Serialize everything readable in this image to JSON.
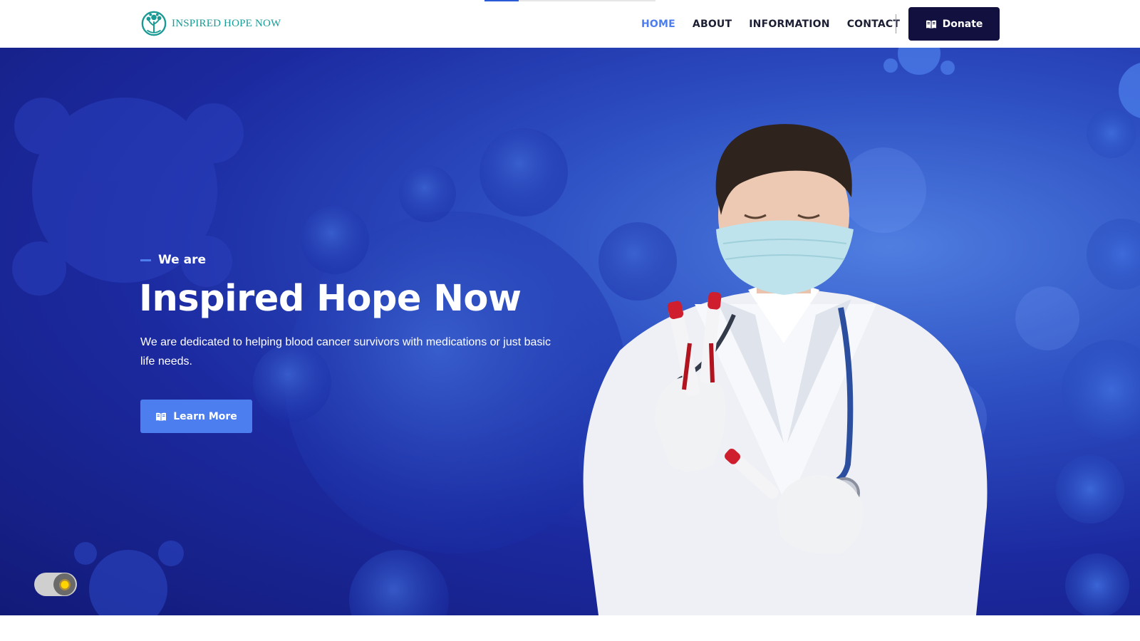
{
  "header": {
    "logo": {
      "text": "INSPIRED HOPE NOW",
      "icon": "tree-leaf-logo-icon",
      "color": "#1a9a94"
    },
    "scroll_progress": 0.2,
    "nav": [
      {
        "label": "HOME",
        "active": true
      },
      {
        "label": "ABOUT",
        "active": false
      },
      {
        "label": "INFORMATION",
        "active": false
      },
      {
        "label": "CONTACT",
        "active": false
      }
    ],
    "donate": {
      "label": "Donate",
      "icon": "book-icon"
    }
  },
  "hero": {
    "tagline": "We are",
    "title": "Inspired Hope Now",
    "subtitle": "We are dedicated to helping blood cancer survivors with medications or just basic life needs.",
    "cta": {
      "label": "Learn More",
      "icon": "book-icon"
    },
    "image": {
      "subject": "doctor-with-mask-holding-blood-sample-tubes",
      "background": "virus-particles"
    }
  },
  "theme_toggle": {
    "icon": "sun-icon"
  },
  "colors": {
    "accent": "#4d7ef0",
    "nav_text": "#1c1f33",
    "donate_bg": "#12103f",
    "hero_bg": "#1c2aa0",
    "logo": "#1a9a94"
  }
}
